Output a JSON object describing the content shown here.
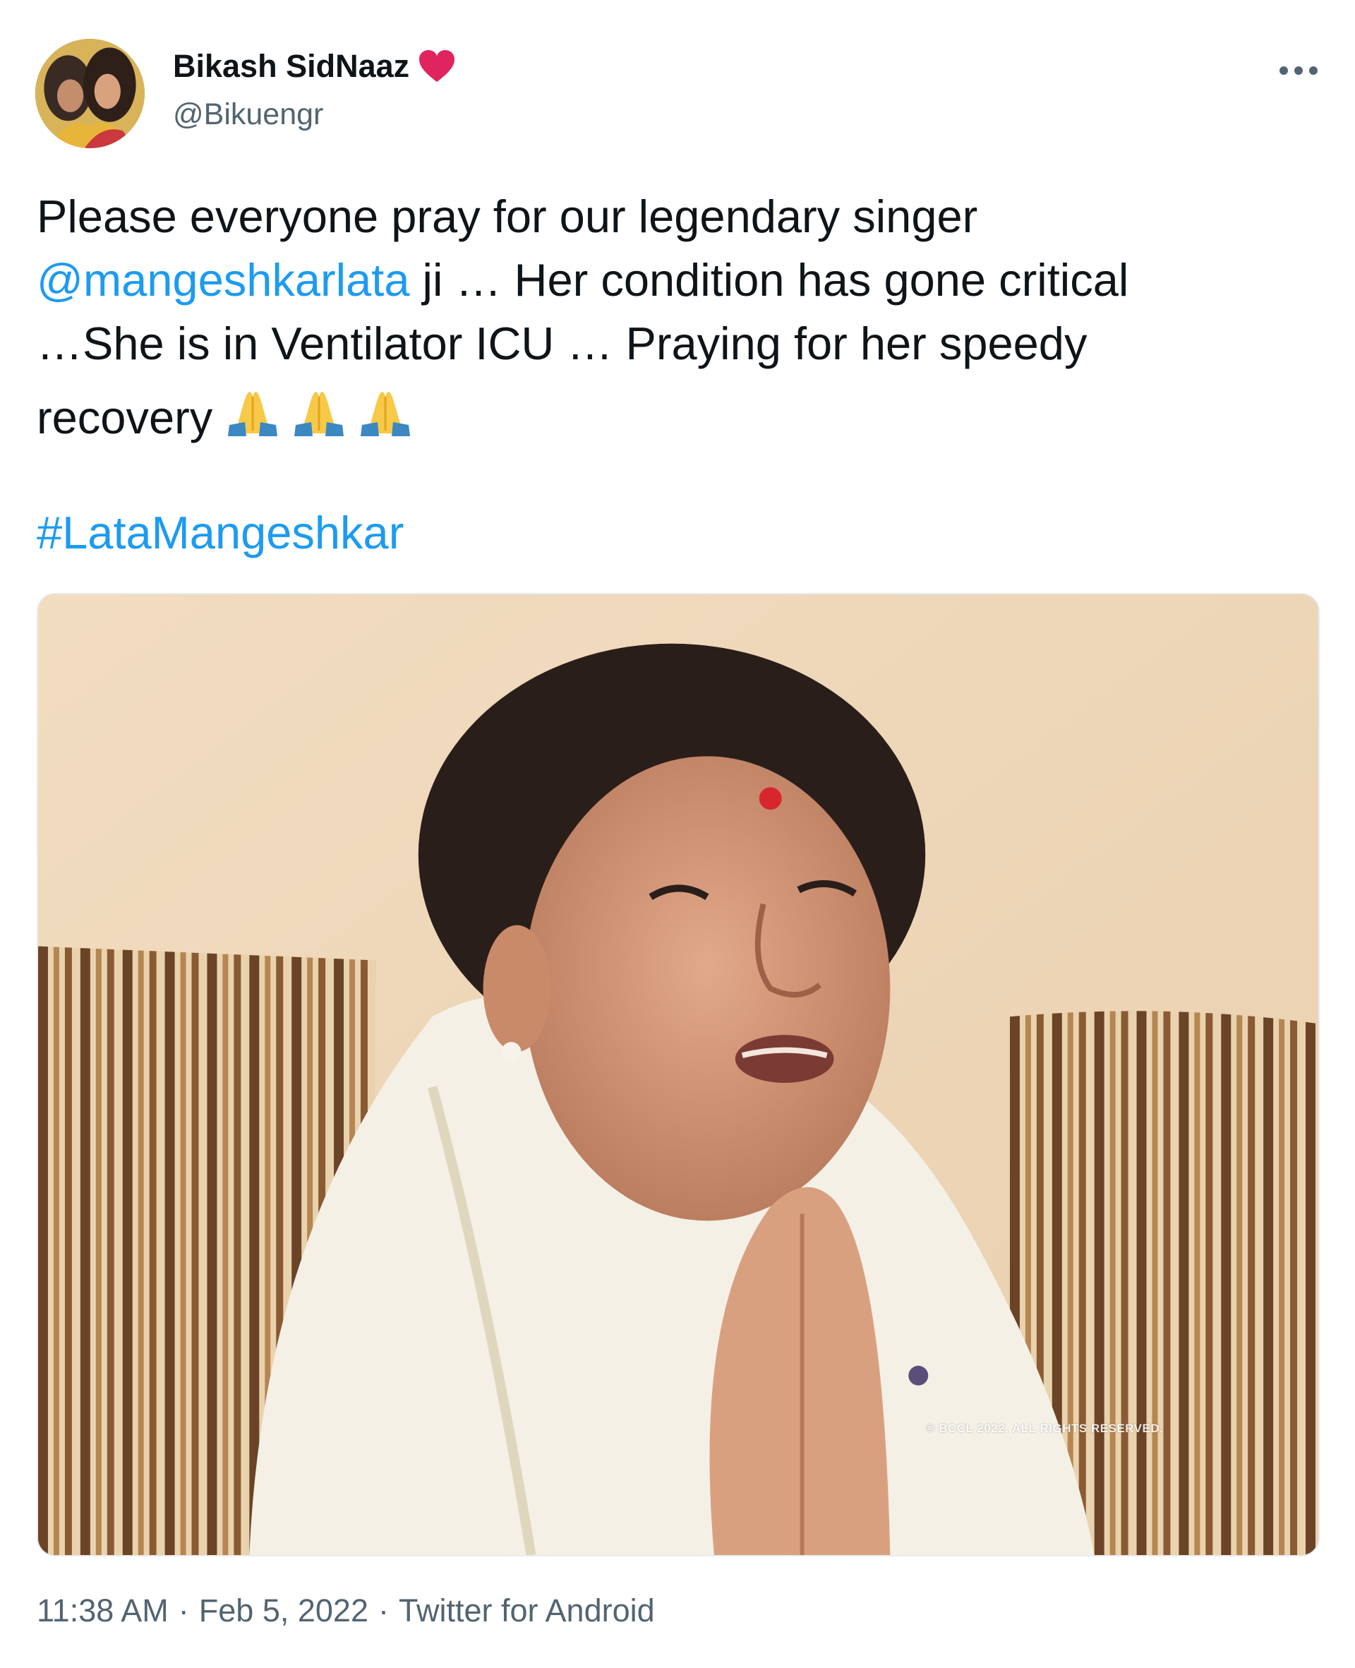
{
  "author": {
    "display_name": "Bikash SidNaaz",
    "handle": "@Bikuengr",
    "badge_icon": "red-heart-icon",
    "avatar_icon": "profile-photo-avatar"
  },
  "menu": {
    "more_icon": "more-options-icon"
  },
  "tweet": {
    "line1": "Please everyone pray for our legendary singer",
    "mention": "@mangeshkarlata",
    "line2_rest": " ji … Her condition has gone critical",
    "line3": "…She is in Ventilator ICU … Praying for her speedy",
    "line4": "recovery",
    "emoji": [
      "folded-hands-icon",
      "folded-hands-icon",
      "folded-hands-icon"
    ],
    "hashtag": "#LataMangeshkar"
  },
  "media": {
    "watermark": "© BCCL 2022. ALL RIGHTS RESERVED."
  },
  "footer": {
    "time": "11:38 AM",
    "date": "Feb 5, 2022",
    "source": "Twitter for Android",
    "separator": "·"
  },
  "colors": {
    "link": "#1d9bf0",
    "text": "#0f1419",
    "secondary": "#536471",
    "heart": "#e0245e"
  }
}
